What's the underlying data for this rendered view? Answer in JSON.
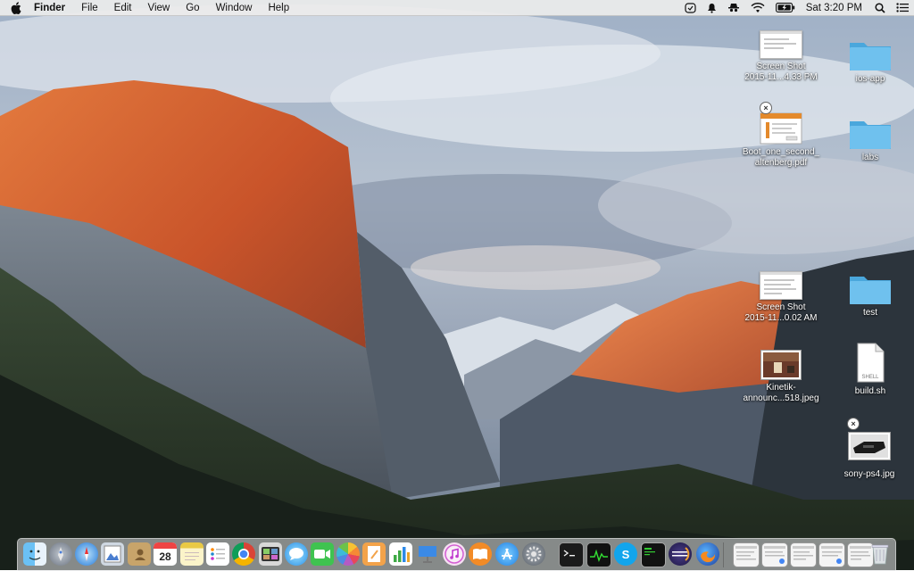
{
  "menubar": {
    "apple_icon": "apple-logo-icon",
    "app_name": "Finder",
    "menus": [
      "File",
      "Edit",
      "View",
      "Go",
      "Window",
      "Help"
    ],
    "status_icons": [
      "notification-icon",
      "bell-icon",
      "spy-icon",
      "wifi-icon",
      "battery-icon"
    ],
    "clock": "Sat 3:20 PM",
    "search_icon": "spotlight-icon",
    "list_icon": "notification-center-icon"
  },
  "desktop": {
    "items": [
      {
        "label1": "Screen Shot",
        "label2": "2015-11...4.33 PM",
        "kind": "screenshot"
      },
      {
        "label1": "ios-app",
        "label2": "",
        "kind": "folder"
      },
      {
        "label1": "Boot_one_second_",
        "label2": "altenberg.pdf",
        "kind": "pdf"
      },
      {
        "label1": "labs",
        "label2": "",
        "kind": "folder"
      },
      {
        "label1": "Screen Shot",
        "label2": "2015-11...0.02 AM",
        "kind": "screenshot"
      },
      {
        "label1": "test",
        "label2": "",
        "kind": "folder"
      },
      {
        "label1": "Kinetik-",
        "label2": "announc...518.jpeg",
        "kind": "jpeg"
      },
      {
        "label1": "build.sh",
        "label2": "",
        "kind": "shell"
      },
      {
        "label1": "sony-ps4.jpg",
        "label2": "",
        "kind": "jpeg"
      }
    ],
    "shell_badge": "SHELL"
  },
  "dock": {
    "calendar_day": "28",
    "apps": [
      "Finder",
      "Launchpad",
      "Safari",
      "Preview",
      "Contacts",
      "Calendar",
      "Notes",
      "Reminders",
      "Google Chrome",
      "Photo Booth",
      "Messages",
      "FaceTime",
      "Photos",
      "Pages",
      "Numbers",
      "Keynote",
      "iTunes",
      "iBooks",
      "App Store",
      "System Preferences",
      "Terminal",
      "Activity Monitor",
      "Skype",
      "Terminal 2",
      "Eclipse",
      "Firefox"
    ],
    "minimized": [
      "window-1",
      "window-2",
      "window-3",
      "window-4",
      "window-5"
    ],
    "trash": "Trash"
  },
  "colors": {
    "menubar_bg": "#ececec",
    "folder": "#5ab4e6",
    "dock_bg": "#e1e1e6"
  }
}
